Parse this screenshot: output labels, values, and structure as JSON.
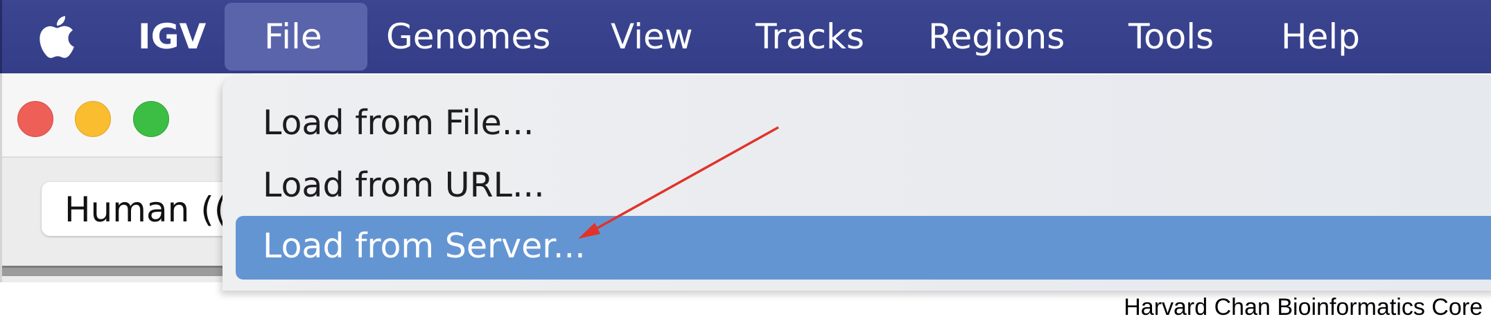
{
  "menubar": {
    "app_name": "IGV",
    "items": [
      {
        "label": "File",
        "active": true
      },
      {
        "label": "Genomes"
      },
      {
        "label": "View"
      },
      {
        "label": "Tracks"
      },
      {
        "label": "Regions"
      },
      {
        "label": "Tools"
      },
      {
        "label": "Help"
      }
    ],
    "apple_icon": "apple-logo-icon",
    "colors": {
      "bar": "#3b4590",
      "active_item": "#5a64ab"
    }
  },
  "window": {
    "traffic_lights": [
      "close-icon",
      "minimize-icon",
      "zoom-icon"
    ],
    "genome_selector_value": "Human (("
  },
  "file_menu": {
    "items": [
      {
        "label": "Load from File..."
      },
      {
        "label": "Load from URL..."
      },
      {
        "label": "Load from Server...",
        "highlighted": true
      }
    ],
    "highlight_color": "#6495d3"
  },
  "annotation": {
    "arrow_color": "#e0332a",
    "points_to": "Load from Server..."
  },
  "caption": "Harvard Chan Bioinformatics Core"
}
